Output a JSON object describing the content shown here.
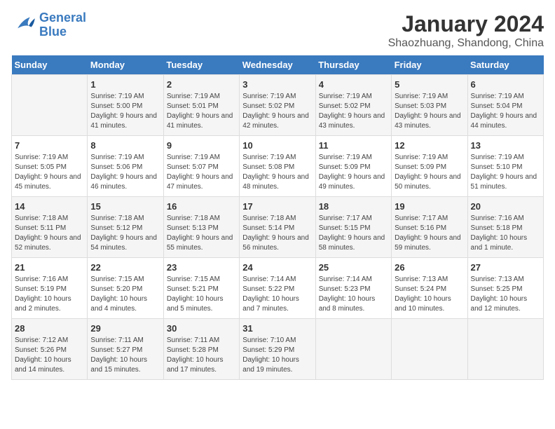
{
  "logo": {
    "text_general": "General",
    "text_blue": "Blue"
  },
  "title": "January 2024",
  "subtitle": "Shaozhuang, Shandong, China",
  "days_of_week": [
    "Sunday",
    "Monday",
    "Tuesday",
    "Wednesday",
    "Thursday",
    "Friday",
    "Saturday"
  ],
  "weeks": [
    [
      {
        "day": "",
        "sunrise": "",
        "sunset": "",
        "daylight": ""
      },
      {
        "day": "1",
        "sunrise": "Sunrise: 7:19 AM",
        "sunset": "Sunset: 5:00 PM",
        "daylight": "Daylight: 9 hours and 41 minutes."
      },
      {
        "day": "2",
        "sunrise": "Sunrise: 7:19 AM",
        "sunset": "Sunset: 5:01 PM",
        "daylight": "Daylight: 9 hours and 41 minutes."
      },
      {
        "day": "3",
        "sunrise": "Sunrise: 7:19 AM",
        "sunset": "Sunset: 5:02 PM",
        "daylight": "Daylight: 9 hours and 42 minutes."
      },
      {
        "day": "4",
        "sunrise": "Sunrise: 7:19 AM",
        "sunset": "Sunset: 5:02 PM",
        "daylight": "Daylight: 9 hours and 43 minutes."
      },
      {
        "day": "5",
        "sunrise": "Sunrise: 7:19 AM",
        "sunset": "Sunset: 5:03 PM",
        "daylight": "Daylight: 9 hours and 43 minutes."
      },
      {
        "day": "6",
        "sunrise": "Sunrise: 7:19 AM",
        "sunset": "Sunset: 5:04 PM",
        "daylight": "Daylight: 9 hours and 44 minutes."
      }
    ],
    [
      {
        "day": "7",
        "sunrise": "Sunrise: 7:19 AM",
        "sunset": "Sunset: 5:05 PM",
        "daylight": "Daylight: 9 hours and 45 minutes."
      },
      {
        "day": "8",
        "sunrise": "Sunrise: 7:19 AM",
        "sunset": "Sunset: 5:06 PM",
        "daylight": "Daylight: 9 hours and 46 minutes."
      },
      {
        "day": "9",
        "sunrise": "Sunrise: 7:19 AM",
        "sunset": "Sunset: 5:07 PM",
        "daylight": "Daylight: 9 hours and 47 minutes."
      },
      {
        "day": "10",
        "sunrise": "Sunrise: 7:19 AM",
        "sunset": "Sunset: 5:08 PM",
        "daylight": "Daylight: 9 hours and 48 minutes."
      },
      {
        "day": "11",
        "sunrise": "Sunrise: 7:19 AM",
        "sunset": "Sunset: 5:09 PM",
        "daylight": "Daylight: 9 hours and 49 minutes."
      },
      {
        "day": "12",
        "sunrise": "Sunrise: 7:19 AM",
        "sunset": "Sunset: 5:09 PM",
        "daylight": "Daylight: 9 hours and 50 minutes."
      },
      {
        "day": "13",
        "sunrise": "Sunrise: 7:19 AM",
        "sunset": "Sunset: 5:10 PM",
        "daylight": "Daylight: 9 hours and 51 minutes."
      }
    ],
    [
      {
        "day": "14",
        "sunrise": "Sunrise: 7:18 AM",
        "sunset": "Sunset: 5:11 PM",
        "daylight": "Daylight: 9 hours and 52 minutes."
      },
      {
        "day": "15",
        "sunrise": "Sunrise: 7:18 AM",
        "sunset": "Sunset: 5:12 PM",
        "daylight": "Daylight: 9 hours and 54 minutes."
      },
      {
        "day": "16",
        "sunrise": "Sunrise: 7:18 AM",
        "sunset": "Sunset: 5:13 PM",
        "daylight": "Daylight: 9 hours and 55 minutes."
      },
      {
        "day": "17",
        "sunrise": "Sunrise: 7:18 AM",
        "sunset": "Sunset: 5:14 PM",
        "daylight": "Daylight: 9 hours and 56 minutes."
      },
      {
        "day": "18",
        "sunrise": "Sunrise: 7:17 AM",
        "sunset": "Sunset: 5:15 PM",
        "daylight": "Daylight: 9 hours and 58 minutes."
      },
      {
        "day": "19",
        "sunrise": "Sunrise: 7:17 AM",
        "sunset": "Sunset: 5:16 PM",
        "daylight": "Daylight: 9 hours and 59 minutes."
      },
      {
        "day": "20",
        "sunrise": "Sunrise: 7:16 AM",
        "sunset": "Sunset: 5:18 PM",
        "daylight": "Daylight: 10 hours and 1 minute."
      }
    ],
    [
      {
        "day": "21",
        "sunrise": "Sunrise: 7:16 AM",
        "sunset": "Sunset: 5:19 PM",
        "daylight": "Daylight: 10 hours and 2 minutes."
      },
      {
        "day": "22",
        "sunrise": "Sunrise: 7:15 AM",
        "sunset": "Sunset: 5:20 PM",
        "daylight": "Daylight: 10 hours and 4 minutes."
      },
      {
        "day": "23",
        "sunrise": "Sunrise: 7:15 AM",
        "sunset": "Sunset: 5:21 PM",
        "daylight": "Daylight: 10 hours and 5 minutes."
      },
      {
        "day": "24",
        "sunrise": "Sunrise: 7:14 AM",
        "sunset": "Sunset: 5:22 PM",
        "daylight": "Daylight: 10 hours and 7 minutes."
      },
      {
        "day": "25",
        "sunrise": "Sunrise: 7:14 AM",
        "sunset": "Sunset: 5:23 PM",
        "daylight": "Daylight: 10 hours and 8 minutes."
      },
      {
        "day": "26",
        "sunrise": "Sunrise: 7:13 AM",
        "sunset": "Sunset: 5:24 PM",
        "daylight": "Daylight: 10 hours and 10 minutes."
      },
      {
        "day": "27",
        "sunrise": "Sunrise: 7:13 AM",
        "sunset": "Sunset: 5:25 PM",
        "daylight": "Daylight: 10 hours and 12 minutes."
      }
    ],
    [
      {
        "day": "28",
        "sunrise": "Sunrise: 7:12 AM",
        "sunset": "Sunset: 5:26 PM",
        "daylight": "Daylight: 10 hours and 14 minutes."
      },
      {
        "day": "29",
        "sunrise": "Sunrise: 7:11 AM",
        "sunset": "Sunset: 5:27 PM",
        "daylight": "Daylight: 10 hours and 15 minutes."
      },
      {
        "day": "30",
        "sunrise": "Sunrise: 7:11 AM",
        "sunset": "Sunset: 5:28 PM",
        "daylight": "Daylight: 10 hours and 17 minutes."
      },
      {
        "day": "31",
        "sunrise": "Sunrise: 7:10 AM",
        "sunset": "Sunset: 5:29 PM",
        "daylight": "Daylight: 10 hours and 19 minutes."
      },
      {
        "day": "",
        "sunrise": "",
        "sunset": "",
        "daylight": ""
      },
      {
        "day": "",
        "sunrise": "",
        "sunset": "",
        "daylight": ""
      },
      {
        "day": "",
        "sunrise": "",
        "sunset": "",
        "daylight": ""
      }
    ]
  ]
}
